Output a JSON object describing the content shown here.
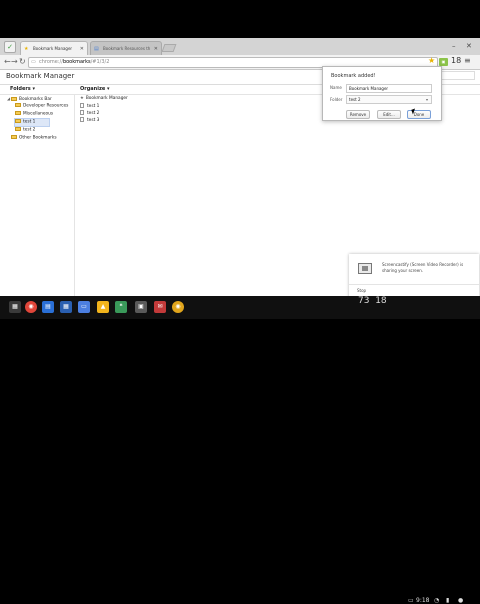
{
  "tabs": [
    {
      "title": "Bookmark Manager",
      "active": true
    },
    {
      "title": "Bookmark Resources th",
      "active": false
    }
  ],
  "toolbar": {
    "url_scheme": "chrome://",
    "url_host": "bookmarks",
    "url_path": "/#1/3/2",
    "profile_badge": "18"
  },
  "page": {
    "title": "Bookmark Manager",
    "folders_menu": "Folders ▾",
    "organize_menu": "Organize ▾"
  },
  "folder_tree": [
    {
      "label": "Bookmarks Bar",
      "expander": "◢",
      "level": 0
    },
    {
      "label": "Developer Resources",
      "level": 1
    },
    {
      "label": "Miscellaneous",
      "level": 1
    },
    {
      "label": "test 1",
      "level": 1,
      "selected": true
    },
    {
      "label": "test 2",
      "level": 1
    },
    {
      "label": "Other Bookmarks",
      "level": 0
    }
  ],
  "bookmark_list": [
    {
      "label": "Bookmark Manager",
      "kind": "star"
    },
    {
      "label": "test 1",
      "kind": "page"
    },
    {
      "label": "test 2",
      "kind": "page"
    },
    {
      "label": "test 3",
      "kind": "page"
    }
  ],
  "bubble": {
    "title": "Bookmark added!",
    "name_label": "Name",
    "name_value": "Bookmark Manager",
    "folder_label": "Folder",
    "folder_value": "test 2",
    "remove_label": "Remove",
    "edit_label": "Edit...",
    "done_label": "Done"
  },
  "notification": {
    "text": "Screencastify (Screen Video Recorder) is sharing your screen.",
    "stop_label": "Stop"
  },
  "shelf": {
    "counter_a": "73",
    "counter_b": "18",
    "time": "9:18"
  },
  "colors": {
    "star": "#e8b200",
    "folder": "#f5cc56",
    "selection": "#dde7f7"
  }
}
